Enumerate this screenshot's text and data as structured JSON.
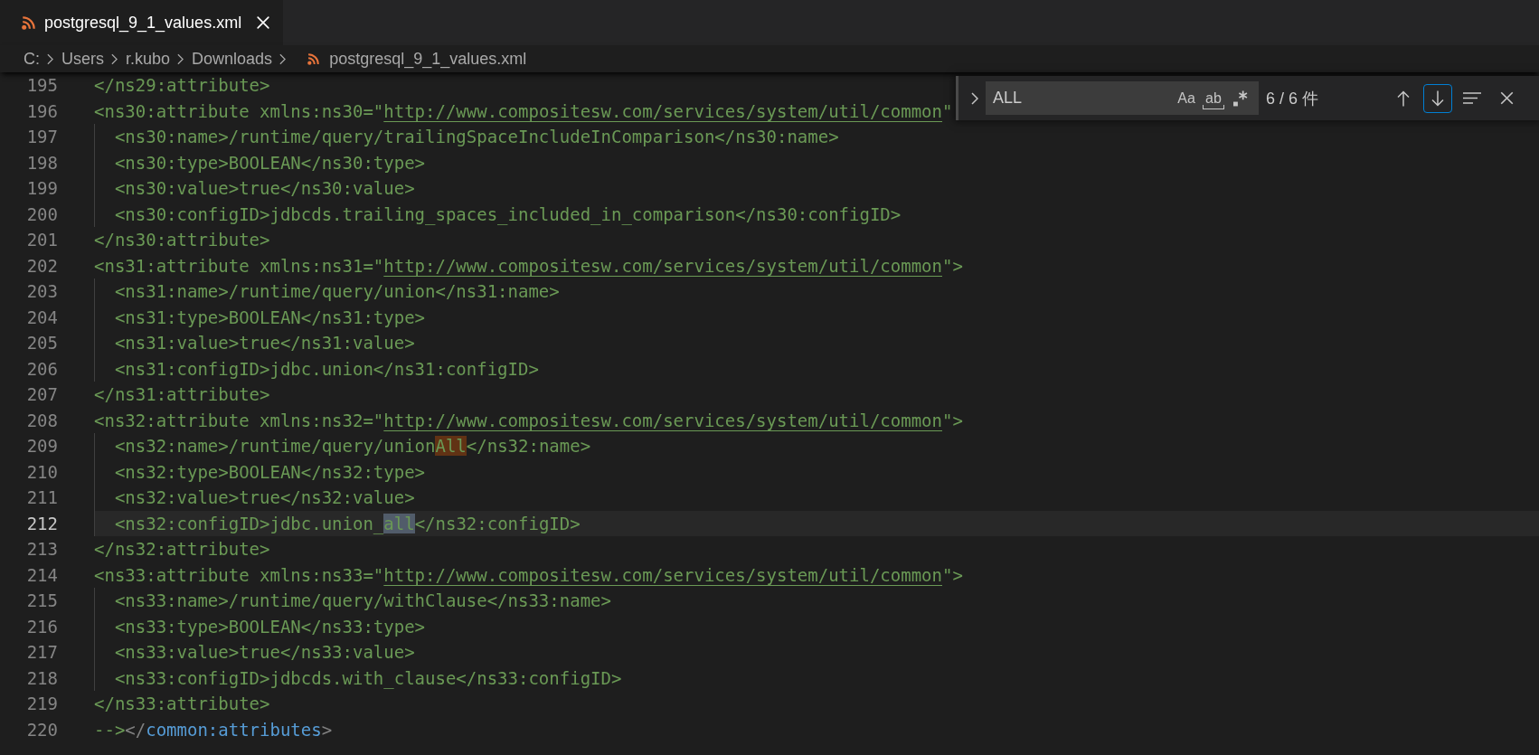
{
  "tab_bar": {
    "tabs": [
      {
        "label": "postgresql_9_1_values.xml",
        "selected": true
      }
    ]
  },
  "breadcrumbs": [
    {
      "label": "C:",
      "kind": "folder"
    },
    {
      "label": "Users",
      "kind": "folder"
    },
    {
      "label": "r.kubo",
      "kind": "folder"
    },
    {
      "label": "Downloads",
      "kind": "folder"
    },
    {
      "label": "postgresql_9_1_values.xml",
      "kind": "file"
    }
  ],
  "editor": {
    "lines": [
      {
        "number": "195",
        "current": false,
        "segments": [
          {
            "kind": "comment",
            "text": "</ns29:attribute>"
          }
        ]
      },
      {
        "number": "196",
        "current": false,
        "segments": [
          {
            "kind": "comment",
            "text": "<ns30:attribute xmlns:ns30=\""
          },
          {
            "kind": "link",
            "text": "http://www.compositesw.com/services/system/util/common"
          },
          {
            "kind": "comment",
            "text": "\""
          }
        ],
        "children": [
          {
            "number": "197",
            "current": false,
            "segments": [
              {
                "kind": "comment",
                "text": "<ns30:name>/runtime/query/trailingSpaceIncludeInComparison</ns30:name>"
              }
            ]
          },
          {
            "number": "198",
            "current": false,
            "segments": [
              {
                "kind": "comment",
                "text": "<ns30:type>BOOLEAN</ns30:type>"
              }
            ]
          },
          {
            "number": "199",
            "current": false,
            "segments": [
              {
                "kind": "comment",
                "text": "<ns30:value>true</ns30:value>"
              }
            ]
          },
          {
            "number": "200",
            "current": false,
            "segments": [
              {
                "kind": "comment",
                "text": "<ns30:configID>jdbcds.trailing_spaces_included_in_comparison</ns30:configID>"
              }
            ]
          }
        ]
      },
      {
        "number": "201",
        "current": false,
        "segments": [
          {
            "kind": "comment",
            "text": "</ns30:attribute>"
          }
        ]
      },
      {
        "number": "202",
        "current": false,
        "segments": [
          {
            "kind": "comment",
            "text": "<ns31:attribute xmlns:ns31=\""
          },
          {
            "kind": "link",
            "text": "http://www.compositesw.com/services/system/util/common"
          },
          {
            "kind": "comment",
            "text": "\">"
          }
        ],
        "children": [
          {
            "number": "203",
            "current": false,
            "segments": [
              {
                "kind": "comment",
                "text": "<ns31:name>/runtime/query/union</ns31:name>"
              }
            ]
          },
          {
            "number": "204",
            "current": false,
            "segments": [
              {
                "kind": "comment",
                "text": "<ns31:type>BOOLEAN</ns31:type>"
              }
            ]
          },
          {
            "number": "205",
            "current": false,
            "segments": [
              {
                "kind": "comment",
                "text": "<ns31:value>true</ns31:value>"
              }
            ]
          },
          {
            "number": "206",
            "current": false,
            "segments": [
              {
                "kind": "comment",
                "text": "<ns31:configID>jdbc.union</ns31:configID>"
              }
            ]
          }
        ]
      },
      {
        "number": "207",
        "current": false,
        "segments": [
          {
            "kind": "comment",
            "text": "</ns31:attribute>"
          }
        ]
      },
      {
        "number": "208",
        "current": false,
        "segments": [
          {
            "kind": "comment",
            "text": "<ns32:attribute xmlns:ns32=\""
          },
          {
            "kind": "link",
            "text": "http://www.compositesw.com/services/system/util/common"
          },
          {
            "kind": "comment",
            "text": "\">"
          }
        ],
        "children": [
          {
            "number": "209",
            "current": false,
            "segments": [
              {
                "kind": "comment",
                "text": "<ns32:name>/runtime/query/union"
              },
              {
                "kind": "match",
                "text": "All"
              },
              {
                "kind": "comment",
                "text": "</ns32:name>"
              }
            ]
          },
          {
            "number": "210",
            "current": false,
            "segments": [
              {
                "kind": "comment",
                "text": "<ns32:type>BOOLEAN</ns32:type>"
              }
            ]
          },
          {
            "number": "211",
            "current": false,
            "segments": [
              {
                "kind": "comment",
                "text": "<ns32:value>true</ns32:value>"
              }
            ]
          },
          {
            "number": "212",
            "current": true,
            "segments": [
              {
                "kind": "comment",
                "text": "<ns32:configID>jdbc.union_"
              },
              {
                "kind": "current-match",
                "text": "all"
              },
              {
                "kind": "comment",
                "text": "</ns32:configID>"
              }
            ]
          }
        ]
      },
      {
        "number": "213",
        "current": false,
        "segments": [
          {
            "kind": "comment",
            "text": "</ns32:attribute>"
          }
        ]
      },
      {
        "number": "214",
        "current": false,
        "segments": [
          {
            "kind": "comment",
            "text": "<ns33:attribute xmlns:ns33=\""
          },
          {
            "kind": "link",
            "text": "http://www.compositesw.com/services/system/util/common"
          },
          {
            "kind": "comment",
            "text": "\">"
          }
        ],
        "children": [
          {
            "number": "215",
            "current": false,
            "segments": [
              {
                "kind": "comment",
                "text": "<ns33:name>/runtime/query/withClause</ns33:name>"
              }
            ]
          },
          {
            "number": "216",
            "current": false,
            "segments": [
              {
                "kind": "comment",
                "text": "<ns33:type>BOOLEAN</ns33:type>"
              }
            ]
          },
          {
            "number": "217",
            "current": false,
            "segments": [
              {
                "kind": "comment",
                "text": "<ns33:value>true</ns33:value>"
              }
            ]
          },
          {
            "number": "218",
            "current": false,
            "segments": [
              {
                "kind": "comment",
                "text": "<ns33:configID>jdbcds.with_clause</ns33:configID>"
              }
            ]
          }
        ]
      },
      {
        "number": "219",
        "current": false,
        "segments": [
          {
            "kind": "comment",
            "text": "</ns33:attribute>"
          }
        ]
      },
      {
        "number": "220",
        "current": false,
        "segments": [
          {
            "kind": "comment",
            "text": "-->"
          },
          {
            "kind": "punct",
            "text": "</"
          },
          {
            "kind": "tag",
            "text": "common:attributes"
          },
          {
            "kind": "punct",
            "text": ">"
          }
        ]
      }
    ]
  },
  "find_widget": {
    "replace_expanded": false,
    "query": "ALL",
    "toggles": [
      {
        "kind": "match-case",
        "label": "Aa",
        "on": false
      },
      {
        "kind": "whole-word",
        "label": "ab",
        "on": false
      },
      {
        "kind": "regex",
        "on": false
      }
    ],
    "count": "6 / 6 件",
    "buttons": [
      {
        "kind": "previous",
        "focused": false
      },
      {
        "kind": "next",
        "focused": true
      },
      {
        "kind": "selection",
        "focused": false
      },
      {
        "kind": "close",
        "focused": false
      }
    ]
  }
}
